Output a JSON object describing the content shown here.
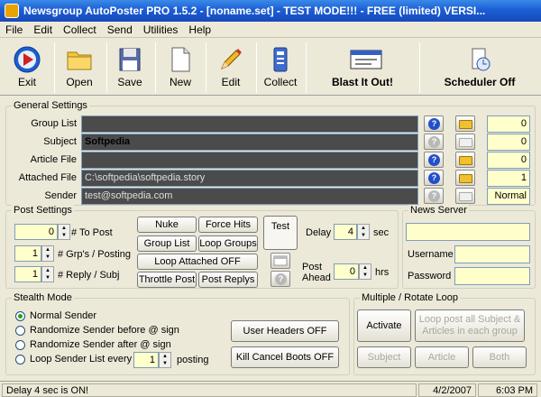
{
  "window": {
    "title": "Newsgroup AutoPoster PRO 1.5.2 - [noname.set] - TEST MODE!!! - FREE (limited) VERSI..."
  },
  "menu": [
    "File",
    "Edit",
    "Collect",
    "Send",
    "Utilities",
    "Help"
  ],
  "toolbar": {
    "exit": "Exit",
    "open": "Open",
    "save": "Save",
    "new": "New",
    "edit": "Edit",
    "collect": "Collect",
    "blast": "Blast It Out!",
    "scheduler": "Scheduler Off"
  },
  "icons": {
    "exit": "play-icon",
    "open": "folder-icon",
    "save": "floppy-disk-icon",
    "new": "new-document-icon",
    "edit": "pencil-icon",
    "collect": "collect-icon",
    "blast": "window-icon",
    "scheduler": "clock-icon",
    "help": "question-icon",
    "browse": "folder-icon"
  },
  "general": {
    "title": "General Settings",
    "rows": [
      {
        "label": "Group List",
        "value": "",
        "count": "0"
      },
      {
        "label": "Subject",
        "value": "Softpedia",
        "count": "0"
      },
      {
        "label": "Article File",
        "value": "",
        "count": "0"
      },
      {
        "label": "Attached File",
        "value": "C:\\softpedia\\softpedia.story",
        "count": "1"
      },
      {
        "label": "Sender",
        "value": "test@softpedia.com",
        "count": "Normal"
      }
    ]
  },
  "post": {
    "title": "Post Settings",
    "to_post_value": "0",
    "to_post_label": "# To Post",
    "grps_value": "1",
    "grps_label": "# Grp's / Posting",
    "reply_value": "1",
    "reply_label": "# Reply / Subj",
    "buttons": {
      "nuke": "Nuke",
      "force_hits": "Force Hits",
      "group_list": "Group List",
      "loop_groups": "Loop Groups",
      "loop_attached": "Loop Attached OFF",
      "throttle": "Throttle Post",
      "post_replys": "Post Replys",
      "test": "Test"
    },
    "delay_label": "Delay",
    "delay_value": "4",
    "delay_unit": "sec",
    "ahead_label1": "Post",
    "ahead_label2": "Ahead",
    "ahead_value": "0",
    "ahead_unit": "hrs"
  },
  "news_server": {
    "title": "News Server",
    "username": "Username",
    "password": "Password"
  },
  "stealth": {
    "title": "Stealth Mode",
    "options": [
      "Normal Sender",
      "Randomize Sender before @ sign",
      "Randomize Sender after @ sign",
      "Loop Sender List every"
    ],
    "loop_value": "1",
    "posting": "posting",
    "user_headers": "User Headers OFF",
    "kill_cancel": "Kill Cancel Boots OFF"
  },
  "rotate": {
    "title": "Multiple / Rotate Loop",
    "activate": "Activate",
    "loop_post1": "Loop post all Subject &",
    "loop_post2": "Articles in each group",
    "subject": "Subject",
    "article": "Article",
    "both": "Both"
  },
  "status": {
    "message": "Delay 4 sec is ON!",
    "date": "4/2/2007",
    "time": "6:03 PM"
  }
}
